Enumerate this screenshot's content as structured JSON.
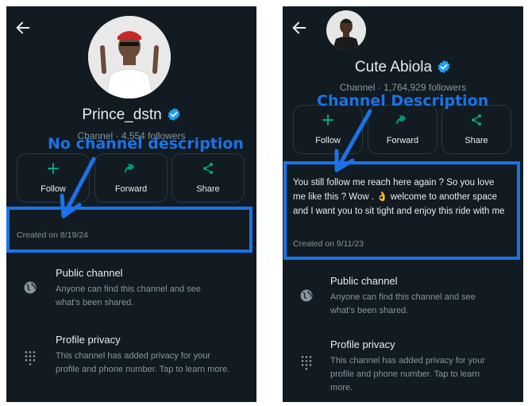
{
  "left": {
    "channel_name": "Prince_dstn",
    "meta": "Channel  ·  4,554 followers",
    "actions": [
      {
        "label": "Follow",
        "icon": "plus-icon"
      },
      {
        "label": "Forward",
        "icon": "forward-icon"
      },
      {
        "label": "Share",
        "icon": "share-icon"
      }
    ],
    "created": "Created on 8/19/24",
    "info": [
      {
        "title": "Public channel",
        "sub": "Anyone can find this channel and see what’s been shared.",
        "icon": "globe-icon"
      },
      {
        "title": "Profile privacy",
        "sub": "This channel has added privacy for your profile and phone number. Tap to learn more.",
        "icon": "dialpad-icon"
      }
    ],
    "annotation": "No channel description"
  },
  "right": {
    "channel_name": "Cute Abiola",
    "meta": "Channel  ·  1,764,929 followers",
    "actions": [
      {
        "label": "Follow",
        "icon": "plus-icon"
      },
      {
        "label": "Forward",
        "icon": "forward-icon"
      },
      {
        "label": "Share",
        "icon": "share-icon"
      }
    ],
    "description": "You still follow me reach here again ? So you love me like this ? Wow . 👌  welcome to another space and I want you to sit tight and enjoy this ride with me",
    "created": "Created on 9/11/23",
    "info": [
      {
        "title": "Public channel",
        "sub": "Anyone can find this channel and see what’s been shared.",
        "icon": "globe-icon"
      },
      {
        "title": "Profile privacy",
        "sub": "This channel has added privacy for your profile and phone number. Tap to learn more.",
        "icon": "dialpad-icon"
      }
    ],
    "annotation": "Channel Description"
  },
  "colors": {
    "background": "#111b21",
    "accent_green": "#00a884",
    "annotation_blue": "#1a73e8",
    "verified_blue": "#1da1f2"
  }
}
